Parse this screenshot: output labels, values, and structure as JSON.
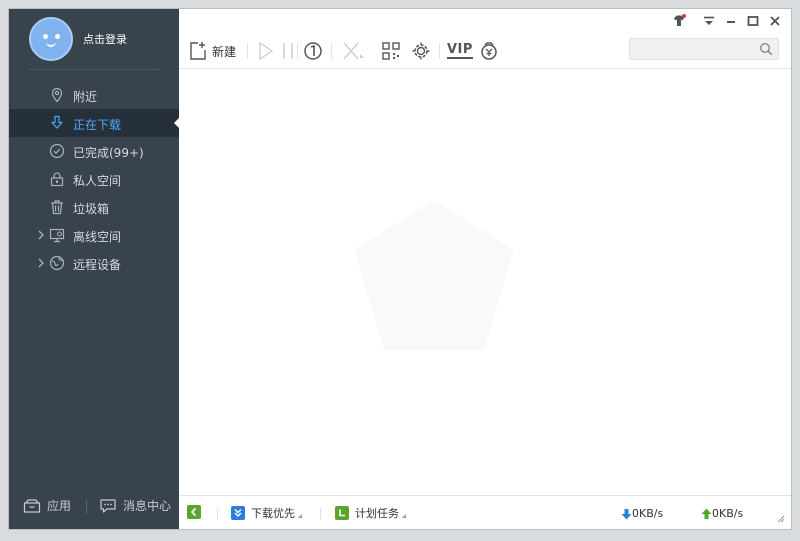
{
  "sidebar": {
    "login_label": "点击登录",
    "items": [
      {
        "label": "附近",
        "icon": "location-icon"
      },
      {
        "label": "正在下载",
        "icon": "download-icon"
      },
      {
        "label": "已完成(99+)",
        "icon": "check-circle-icon"
      },
      {
        "label": "私人空间",
        "icon": "lock-icon"
      },
      {
        "label": "垃圾箱",
        "icon": "trash-icon"
      },
      {
        "label": "离线空间",
        "icon": "offline-space-icon"
      },
      {
        "label": "远程设备",
        "icon": "remote-device-icon"
      }
    ],
    "active_index": 1,
    "apps_label": "应用",
    "messages_label": "消息中心"
  },
  "toolbar": {
    "new_label": "新建",
    "vip_label": "VIP",
    "search_placeholder": ""
  },
  "statusbar": {
    "priority_label": "下载优先",
    "schedule_label": "计划任务",
    "down_speed": "0KB/s",
    "up_speed": "0KB/s"
  },
  "colors": {
    "sidebar_bg": "#39434d",
    "active_bg": "#26303a",
    "active_text": "#4ea8f5",
    "green": "#5aa52f",
    "blue": "#2b7fd8"
  }
}
